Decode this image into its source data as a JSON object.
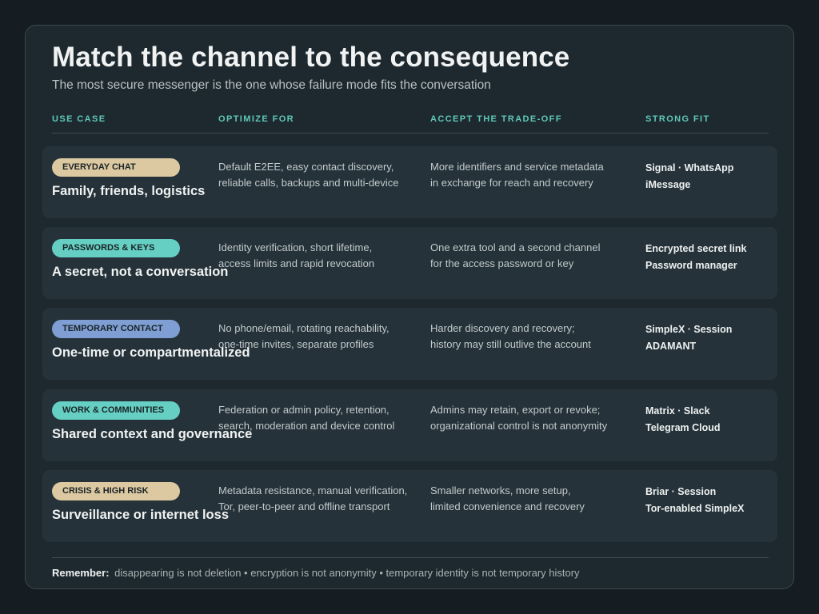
{
  "title": "Match the channel to the consequence",
  "subtitle": "The most secure messenger is the one whose failure mode fits the conversation",
  "columns": {
    "use_case": "USE CASE",
    "optimize_for": "OPTIMIZE FOR",
    "trade_off": "ACCEPT THE TRADE-OFF",
    "strong_fit": "STRONG FIT"
  },
  "colors": {
    "background": "#161d22",
    "card": "#1e292f",
    "row": "#25323a",
    "header_accent": "#5fc8b9",
    "pill_sand": "#dcc9a1",
    "pill_teal": "#66cfc3",
    "pill_blue": "#7f9fd4"
  },
  "rows": [
    {
      "tag": "EVERYDAY CHAT",
      "tag_color": "#dcc9a1",
      "title": "Family, friends, logistics",
      "optimize": [
        "Default E2EE, easy contact discovery,",
        "reliable calls, backups and multi-device"
      ],
      "tradeoff": [
        "More identifiers and service metadata",
        "in exchange for reach and recovery"
      ],
      "fit": [
        "Signal · WhatsApp",
        "iMessage"
      ]
    },
    {
      "tag": "PASSWORDS & KEYS",
      "tag_color": "#66cfc3",
      "title": "A secret, not a conversation",
      "optimize": [
        "Identity verification, short lifetime,",
        "access limits and rapid revocation"
      ],
      "tradeoff": [
        "One extra tool and a second channel",
        "for the access password or key"
      ],
      "fit": [
        "Encrypted secret link",
        "Password manager"
      ]
    },
    {
      "tag": "TEMPORARY CONTACT",
      "tag_color": "#7f9fd4",
      "title": "One-time or compartmentalized",
      "optimize": [
        "No phone/email, rotating reachability,",
        "one-time invites, separate profiles"
      ],
      "tradeoff": [
        "Harder discovery and recovery;",
        "history may still outlive the account"
      ],
      "fit": [
        "SimpleX · Session",
        "ADAMANT"
      ]
    },
    {
      "tag": "WORK & COMMUNITIES",
      "tag_color": "#66cfc3",
      "title": "Shared context and governance",
      "optimize": [
        "Federation or admin policy, retention,",
        "search, moderation and device control"
      ],
      "tradeoff": [
        "Admins may retain, export or revoke;",
        "organizational control is not anonymity"
      ],
      "fit": [
        "Matrix · Slack",
        "Telegram Cloud"
      ]
    },
    {
      "tag": "CRISIS & HIGH RISK",
      "tag_color": "#dcc9a1",
      "title": "Surveillance or internet loss",
      "optimize": [
        "Metadata resistance, manual verification,",
        "Tor, peer-to-peer and offline transport"
      ],
      "tradeoff": [
        "Smaller networks, more setup,",
        "limited convenience and recovery"
      ],
      "fit": [
        "Briar · Session",
        "Tor-enabled SimpleX"
      ]
    }
  ],
  "footer": {
    "lead": "Remember:",
    "text": "disappearing is not deletion • encryption is not anonymity • temporary identity is not temporary history"
  }
}
